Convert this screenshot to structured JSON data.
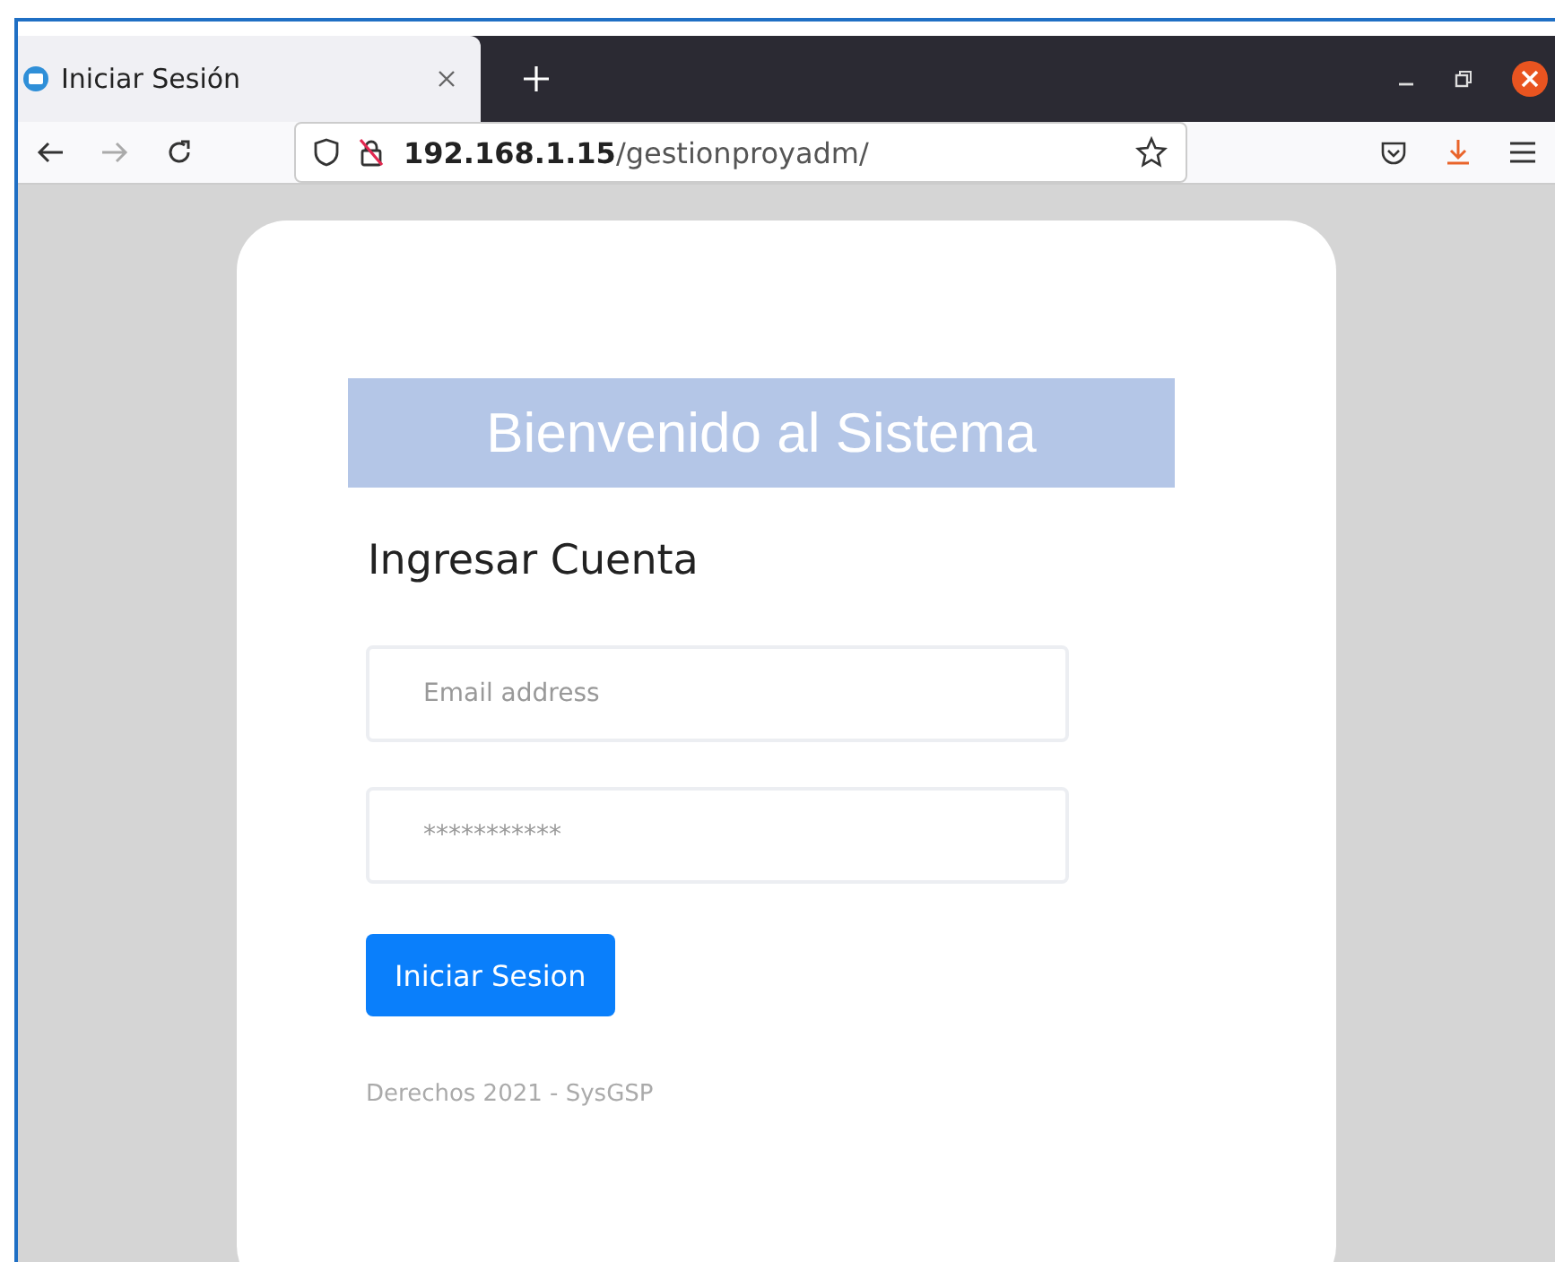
{
  "tabs": [
    {
      "label": "Iniciar Sesión",
      "selected": true
    }
  ],
  "address_bar": {
    "host": "192.168.1.15",
    "path": "/gestionproyadm/"
  },
  "login": {
    "banner": "Bienvenido al Sistema",
    "heading": "Ingresar Cuenta",
    "fields": [
      {
        "placeholder": "Email address"
      },
      {
        "placeholder": "***********"
      }
    ],
    "button": "Iniciar Sesion",
    "footer": "Derechos 2021 - SysGSP"
  }
}
